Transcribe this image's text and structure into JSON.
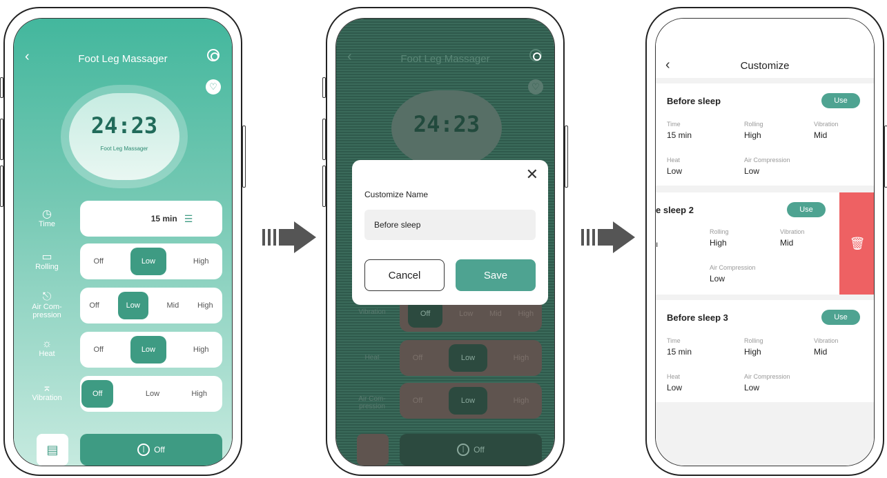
{
  "screen1": {
    "title": "Foot Leg Massager",
    "clock": "24:23",
    "clock_sub": "Foot Leg Massager",
    "rows": [
      {
        "label": "Time",
        "icon": "clock-icon"
      },
      {
        "label": "Rolling",
        "icon": "rolling-icon"
      },
      {
        "label": "Air Com-\npression",
        "icon": "air-icon"
      },
      {
        "label": "Heat",
        "icon": "sun-icon"
      },
      {
        "label": "Vibration",
        "icon": "vibration-icon"
      }
    ],
    "time_value": "15 min",
    "rolling": {
      "off": "Off",
      "low": "Low",
      "high": "High"
    },
    "air": {
      "off": "Off",
      "low": "Low",
      "mid": "Mid",
      "high": "High"
    },
    "heat": {
      "off": "Off",
      "low": "Low",
      "high": "High"
    },
    "vibration": {
      "off": "Off",
      "low": "Low",
      "high": "High"
    },
    "power": "Off"
  },
  "screen2": {
    "title": "Foot Leg Massager",
    "clock": "24:23",
    "dim_row_labels": [
      "Vibration",
      "Heat",
      "Air Com-\npression"
    ],
    "opt_off": "Off",
    "opt_low": "Low",
    "opt_mid": "Mid",
    "opt_high": "High",
    "power": "Off",
    "modal": {
      "title": "Customize Name",
      "input_value": "Before sleep",
      "cancel": "Cancel",
      "save": "Save"
    }
  },
  "screen3": {
    "title": "Customize",
    "use_label": "Use",
    "labels": {
      "time": "Time",
      "rolling": "Rolling",
      "vibration": "Vibration",
      "heat": "Heat",
      "air": "Air Compression"
    },
    "cards": [
      {
        "name": "Before sleep",
        "time": "15 min",
        "rolling": "High",
        "vibration": "Mid",
        "heat": "Low",
        "air": "Low"
      },
      {
        "name": "e sleep 2",
        "time": "ı",
        "rolling": "High",
        "vibration": "Mid",
        "air": "Low"
      },
      {
        "name": "Before sleep 3",
        "time": "15 min",
        "rolling": "High",
        "vibration": "Mid",
        "heat": "Low",
        "air": "Low"
      }
    ]
  },
  "colors": {
    "accent": "#4ea391",
    "delete": "#ee6163"
  }
}
